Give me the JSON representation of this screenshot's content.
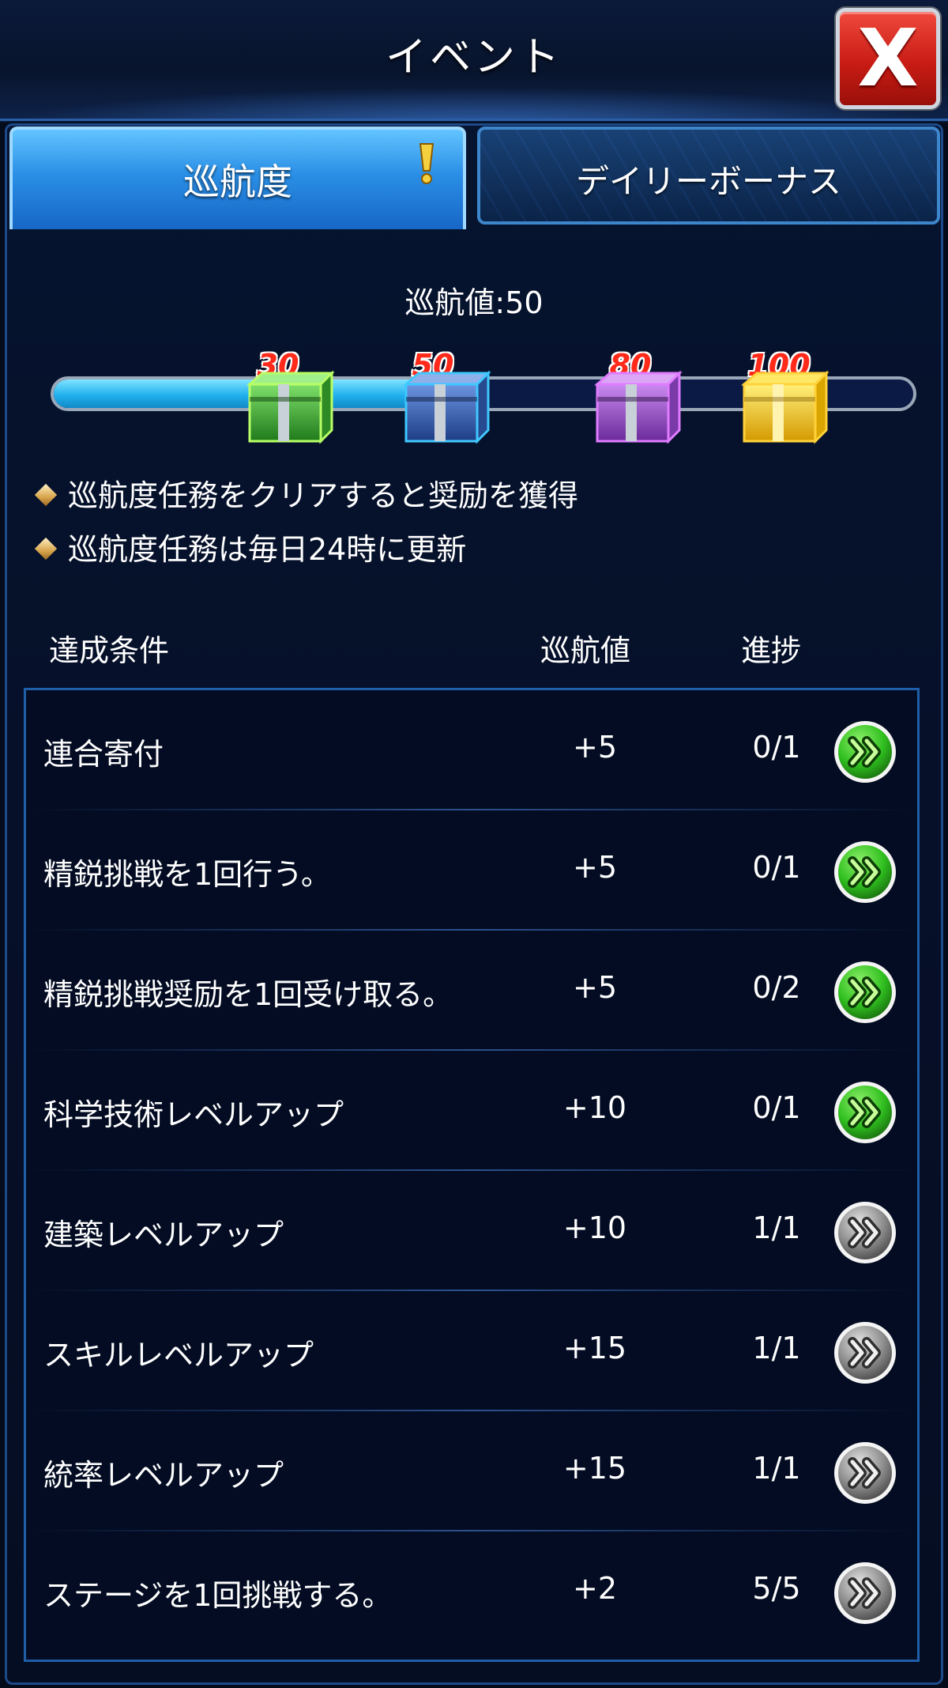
{
  "header": {
    "title": "イベント",
    "close_label": "X"
  },
  "tabs": [
    {
      "label": "巡航度",
      "active": true,
      "alert": true
    },
    {
      "label": "デイリーボーナス",
      "active": false,
      "alert": false
    }
  ],
  "cruise": {
    "label": "巡航値:50",
    "progress_percent": 47,
    "chests": [
      {
        "threshold": "30",
        "color": "#3fbf3a"
      },
      {
        "threshold": "50",
        "color": "#3d6fc8"
      },
      {
        "threshold": "80",
        "color": "#a54fd6"
      },
      {
        "threshold": "100",
        "color": "#f2c21c"
      }
    ]
  },
  "info": [
    "巡航度任務をクリアすると奨励を獲得",
    "巡航度任務は毎日24時に更新"
  ],
  "table": {
    "columns": [
      "達成条件",
      "巡航値",
      "進捗"
    ],
    "rows": [
      {
        "name": "連合寄付",
        "points": "+5",
        "progress": "0/1",
        "status": "available"
      },
      {
        "name": "精鋭挑戦を1回行う。",
        "points": "+5",
        "progress": "0/1",
        "status": "available"
      },
      {
        "name": "精鋭挑戦奨励を1回受け取る。",
        "points": "+5",
        "progress": "0/2",
        "status": "available"
      },
      {
        "name": "科学技術レベルアップ",
        "points": "+10",
        "progress": "0/1",
        "status": "available"
      },
      {
        "name": "建築レベルアップ",
        "points": "+10",
        "progress": "1/1",
        "status": "done"
      },
      {
        "name": "スキルレベルアップ",
        "points": "+15",
        "progress": "1/1",
        "status": "done"
      },
      {
        "name": "統率レベルアップ",
        "points": "+15",
        "progress": "1/1",
        "status": "done"
      },
      {
        "name": "ステージを1回挑戦する。",
        "points": "+2",
        "progress": "5/5",
        "status": "done"
      }
    ]
  },
  "colors": {
    "button_available": "#2fbf1f",
    "button_done": "#8c8c8c",
    "accent": "#2a8fe6"
  },
  "icons": {
    "alert": "exclamation-icon",
    "go": "double-chevron-right-icon",
    "bullet": "diamond-icon",
    "close": "close-icon"
  }
}
